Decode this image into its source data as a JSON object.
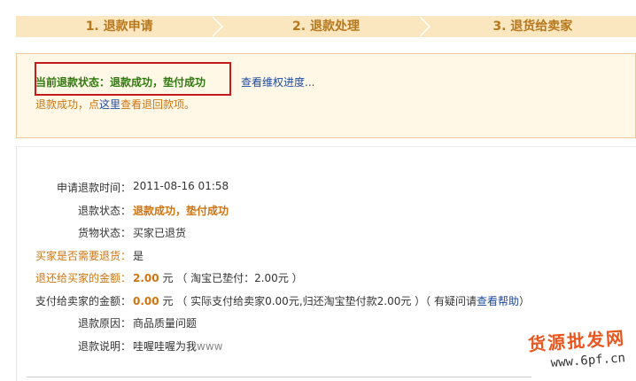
{
  "steps": [
    "1. 退款申请",
    "2. 退款处理",
    "3. 退货给卖家"
  ],
  "status": {
    "title": "当前退款状态：退款成功，垫付成功",
    "progress_link": "查看维权进度...",
    "note_prefix": "退款成功，点",
    "note_here": "这里",
    "note_suffix": "查看退回款项。"
  },
  "details": {
    "apply_time_label": "申请退款时间：",
    "apply_time": "2011-08-16 01:58",
    "refund_status_label": "退款状态：",
    "refund_status": "退款成功，垫付成功",
    "goods_status_label": "货物状态：",
    "goods_status": "买家已退货",
    "need_return_label": "买家是否需要退货：",
    "need_return": "是",
    "refund_amount_label": "退还给买家的金额：",
    "refund_amount": "2.00",
    "refund_amount_unit": "元",
    "refund_amount_note": "（ 淘宝已垫付：2.00元 ）",
    "seller_amount_label": "支付给卖家的金额：",
    "seller_amount": "0.00",
    "seller_amount_unit": "元",
    "seller_amount_note": "（ 实际支付给卖家0.00元,归还淘宝垫付款2.00元 ）（ 有疑问请",
    "help_link": "查看帮助",
    "seller_amount_note_end": "）",
    "reason_label": "退款原因：",
    "reason": "商品质量问题",
    "description_label": "退款说明：",
    "description": "哇喔哇喔为我",
    "description_latin": "www"
  },
  "watermark": {
    "text": "货源批发网",
    "url": "www.6pf.cn"
  },
  "colors": {
    "accent_orange": "#d0740f",
    "status_green": "#2f7a0f",
    "link_blue": "#1c49a0",
    "highlight_red": "#c51b1b",
    "step_bg": "#fbe7bf"
  }
}
